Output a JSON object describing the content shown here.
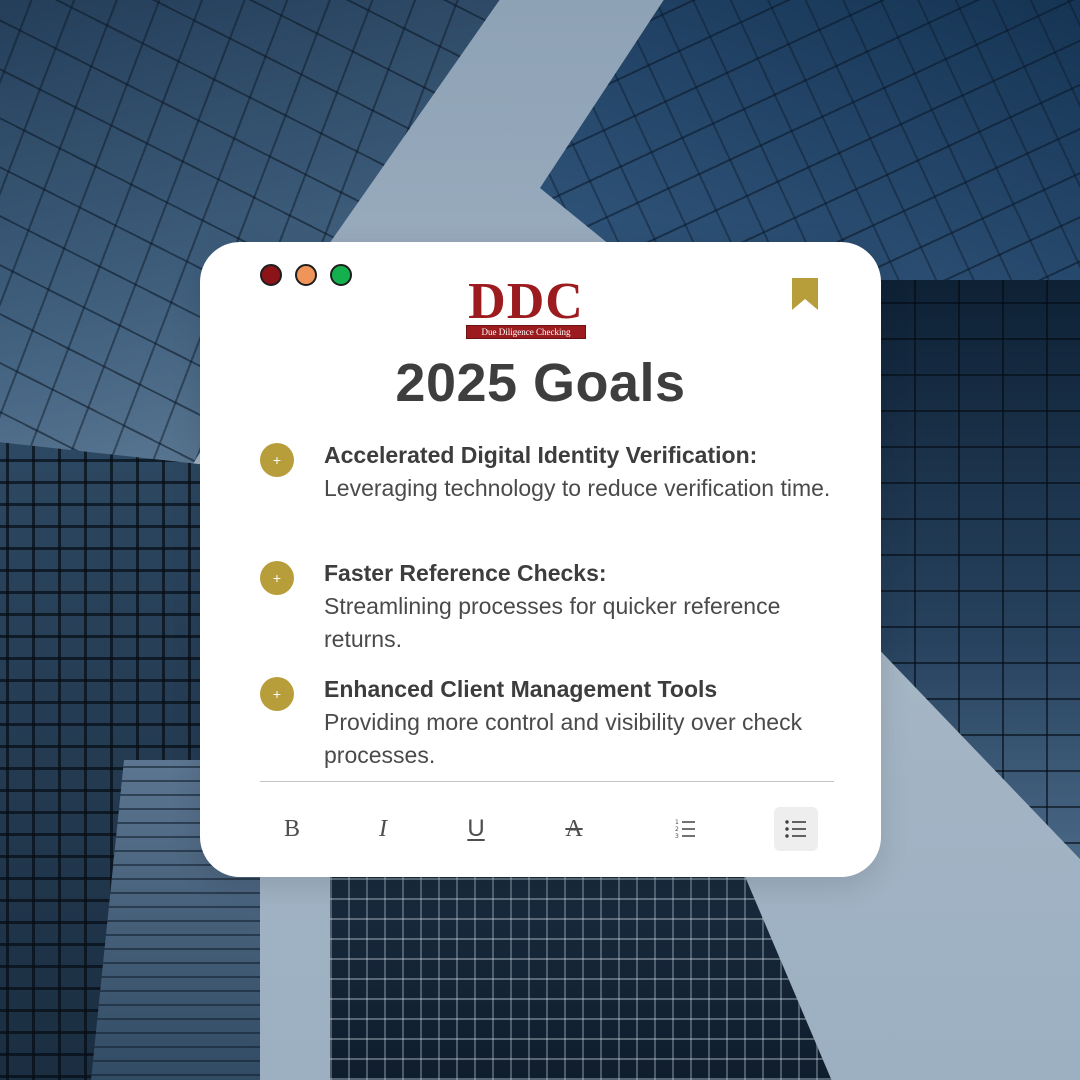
{
  "app": {
    "logo_text": "DDC",
    "logo_subtitle": "Due Diligence Checking",
    "title": "2025 Goals"
  },
  "window_controls": {
    "close_color": "#8c1418",
    "minimize_color": "#f0955a",
    "maximize_color": "#15b04e"
  },
  "accent_color": "#b79e3b",
  "goals": [
    {
      "heading": "Accelerated Digital Identity Verification:",
      "description": "Leveraging technology to reduce verification time."
    },
    {
      "heading": "Faster Reference Checks:",
      "description": "Streamlining processes for quicker reference returns."
    },
    {
      "heading": "Enhanced Client Management Tools",
      "description": "Providing more control and visibility over check processes."
    }
  ],
  "bullet_symbol": "+",
  "toolbar": {
    "bold": "B",
    "italic": "I",
    "underline": "U",
    "strikethrough": "A",
    "icons": [
      "bold-icon",
      "italic-icon",
      "underline-icon",
      "strikethrough-icon",
      "ordered-list-icon",
      "bullet-list-icon"
    ],
    "active": "bullet-list"
  }
}
